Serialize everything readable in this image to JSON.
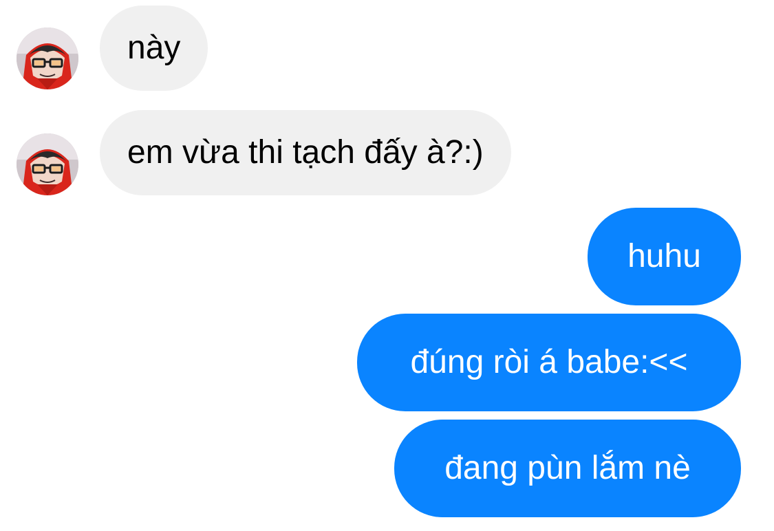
{
  "conversation": {
    "incoming": [
      {
        "text": "này",
        "sender_avatar": "avatar-red-hood-glasses"
      },
      {
        "text": "em vừa thi tạch đấy à?:)",
        "sender_avatar": "avatar-red-hood-glasses"
      }
    ],
    "outgoing": [
      {
        "text": "huhu"
      },
      {
        "text": "đúng ròi á babe:<<"
      },
      {
        "text": "đang pùn lắm nè"
      }
    ]
  },
  "colors": {
    "incoming_bubble": "#f0f0f0",
    "incoming_text": "#000000",
    "outgoing_bubble": "#0a84ff",
    "outgoing_text": "#ffffff",
    "background": "#ffffff"
  }
}
